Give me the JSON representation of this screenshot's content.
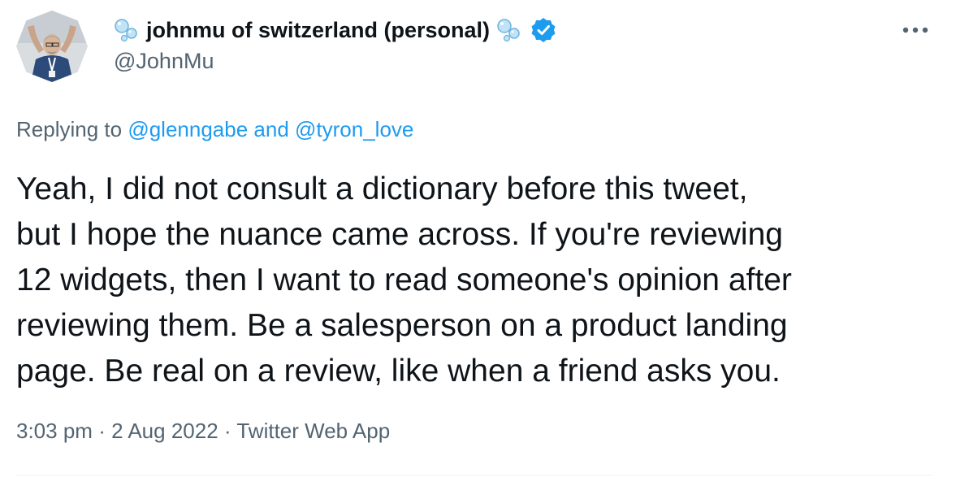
{
  "author": {
    "display_name": "johnmu of switzerland (personal)",
    "handle": "@JohnMu",
    "verified": true
  },
  "reply": {
    "prefix": "Replying to",
    "mention_1": "@glenngabe",
    "joiner": "and",
    "mention_2": "@tyron_love"
  },
  "tweet": {
    "text_lines": [
      "Yeah, I did not consult a dictionary before this tweet,",
      "but I hope the nuance came across. If you're reviewing",
      "12 widgets, then I want to read someone's opinion after",
      "reviewing them. Be a salesperson on a product landing",
      "page. Be real on a review, like when a friend asks you."
    ]
  },
  "meta": {
    "time": "3:03 pm",
    "date": "2 Aug 2022",
    "source": "Twitter Web App",
    "separator": "·"
  },
  "colors": {
    "text": "#0f1419",
    "secondary": "#536471",
    "accent": "#1d9bf0",
    "divider": "#eff3f4"
  },
  "icons": {
    "bubbles": "bubbles-icon",
    "verified": "verified-badge-icon",
    "more": "more-options-icon"
  }
}
